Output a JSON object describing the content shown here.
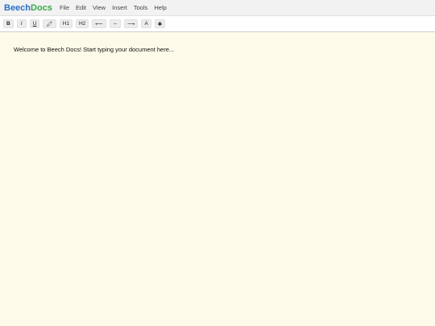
{
  "app": {
    "logo_part_1": "Beech",
    "logo_part_2": "Docs"
  },
  "menu": {
    "items": [
      "File",
      "Edit",
      "View",
      "Insert",
      "Tools",
      "Help"
    ]
  },
  "toolbar": {
    "bold_label": "B",
    "italic_label": "I",
    "underline_label": "U",
    "highlight_label": "🖍",
    "h1_label": "H1",
    "h2_label": "H2",
    "align_left_label": "⟵",
    "align_center_label": "⇔",
    "align_right_label": "⟶",
    "font_color_label": "A",
    "more_label": "✱"
  },
  "editor": {
    "content": "Welcome to Beech Docs! Start typing your document here..."
  },
  "colors": {
    "logo_part_1": "#2a6fc9",
    "logo_part_2": "#3aa84a",
    "editor_background": "#fefae9"
  }
}
